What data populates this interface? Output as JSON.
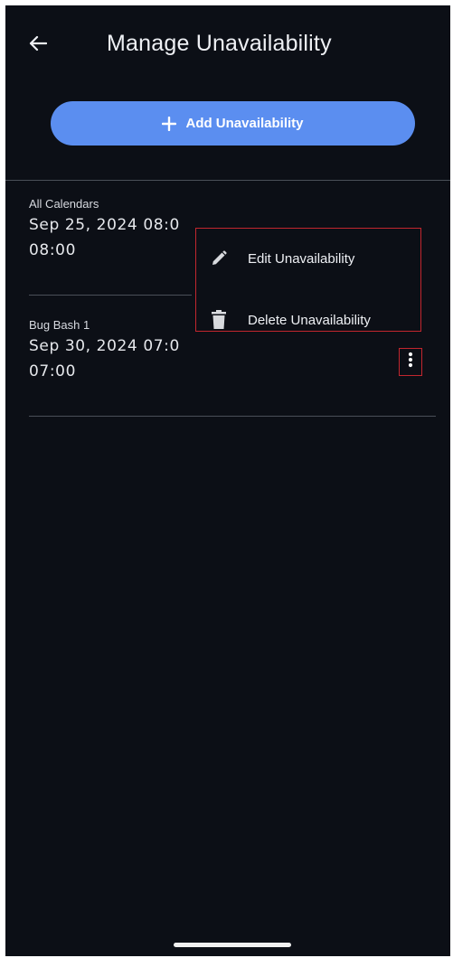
{
  "header": {
    "title": "Manage Unavailability",
    "back_icon": "arrow-left-icon"
  },
  "add_button": {
    "label": "Add Unavailability",
    "icon": "plus-icon",
    "color": "#5b8ef0"
  },
  "items": [
    {
      "calendar": "All Calendars",
      "line1": "Sep 25, 2024 08:0",
      "line2": "08:00"
    },
    {
      "calendar": "Bug Bash 1",
      "line1": "Sep 30, 2024 07:0",
      "line2": "07:00"
    }
  ],
  "context_menu": {
    "items": [
      {
        "label": "Edit Unavailability",
        "icon": "pencil-icon"
      },
      {
        "label": "Delete Unavailability",
        "icon": "trash-icon"
      }
    ]
  },
  "colors": {
    "background": "#0c0f16",
    "highlight_border": "#c2262e"
  }
}
